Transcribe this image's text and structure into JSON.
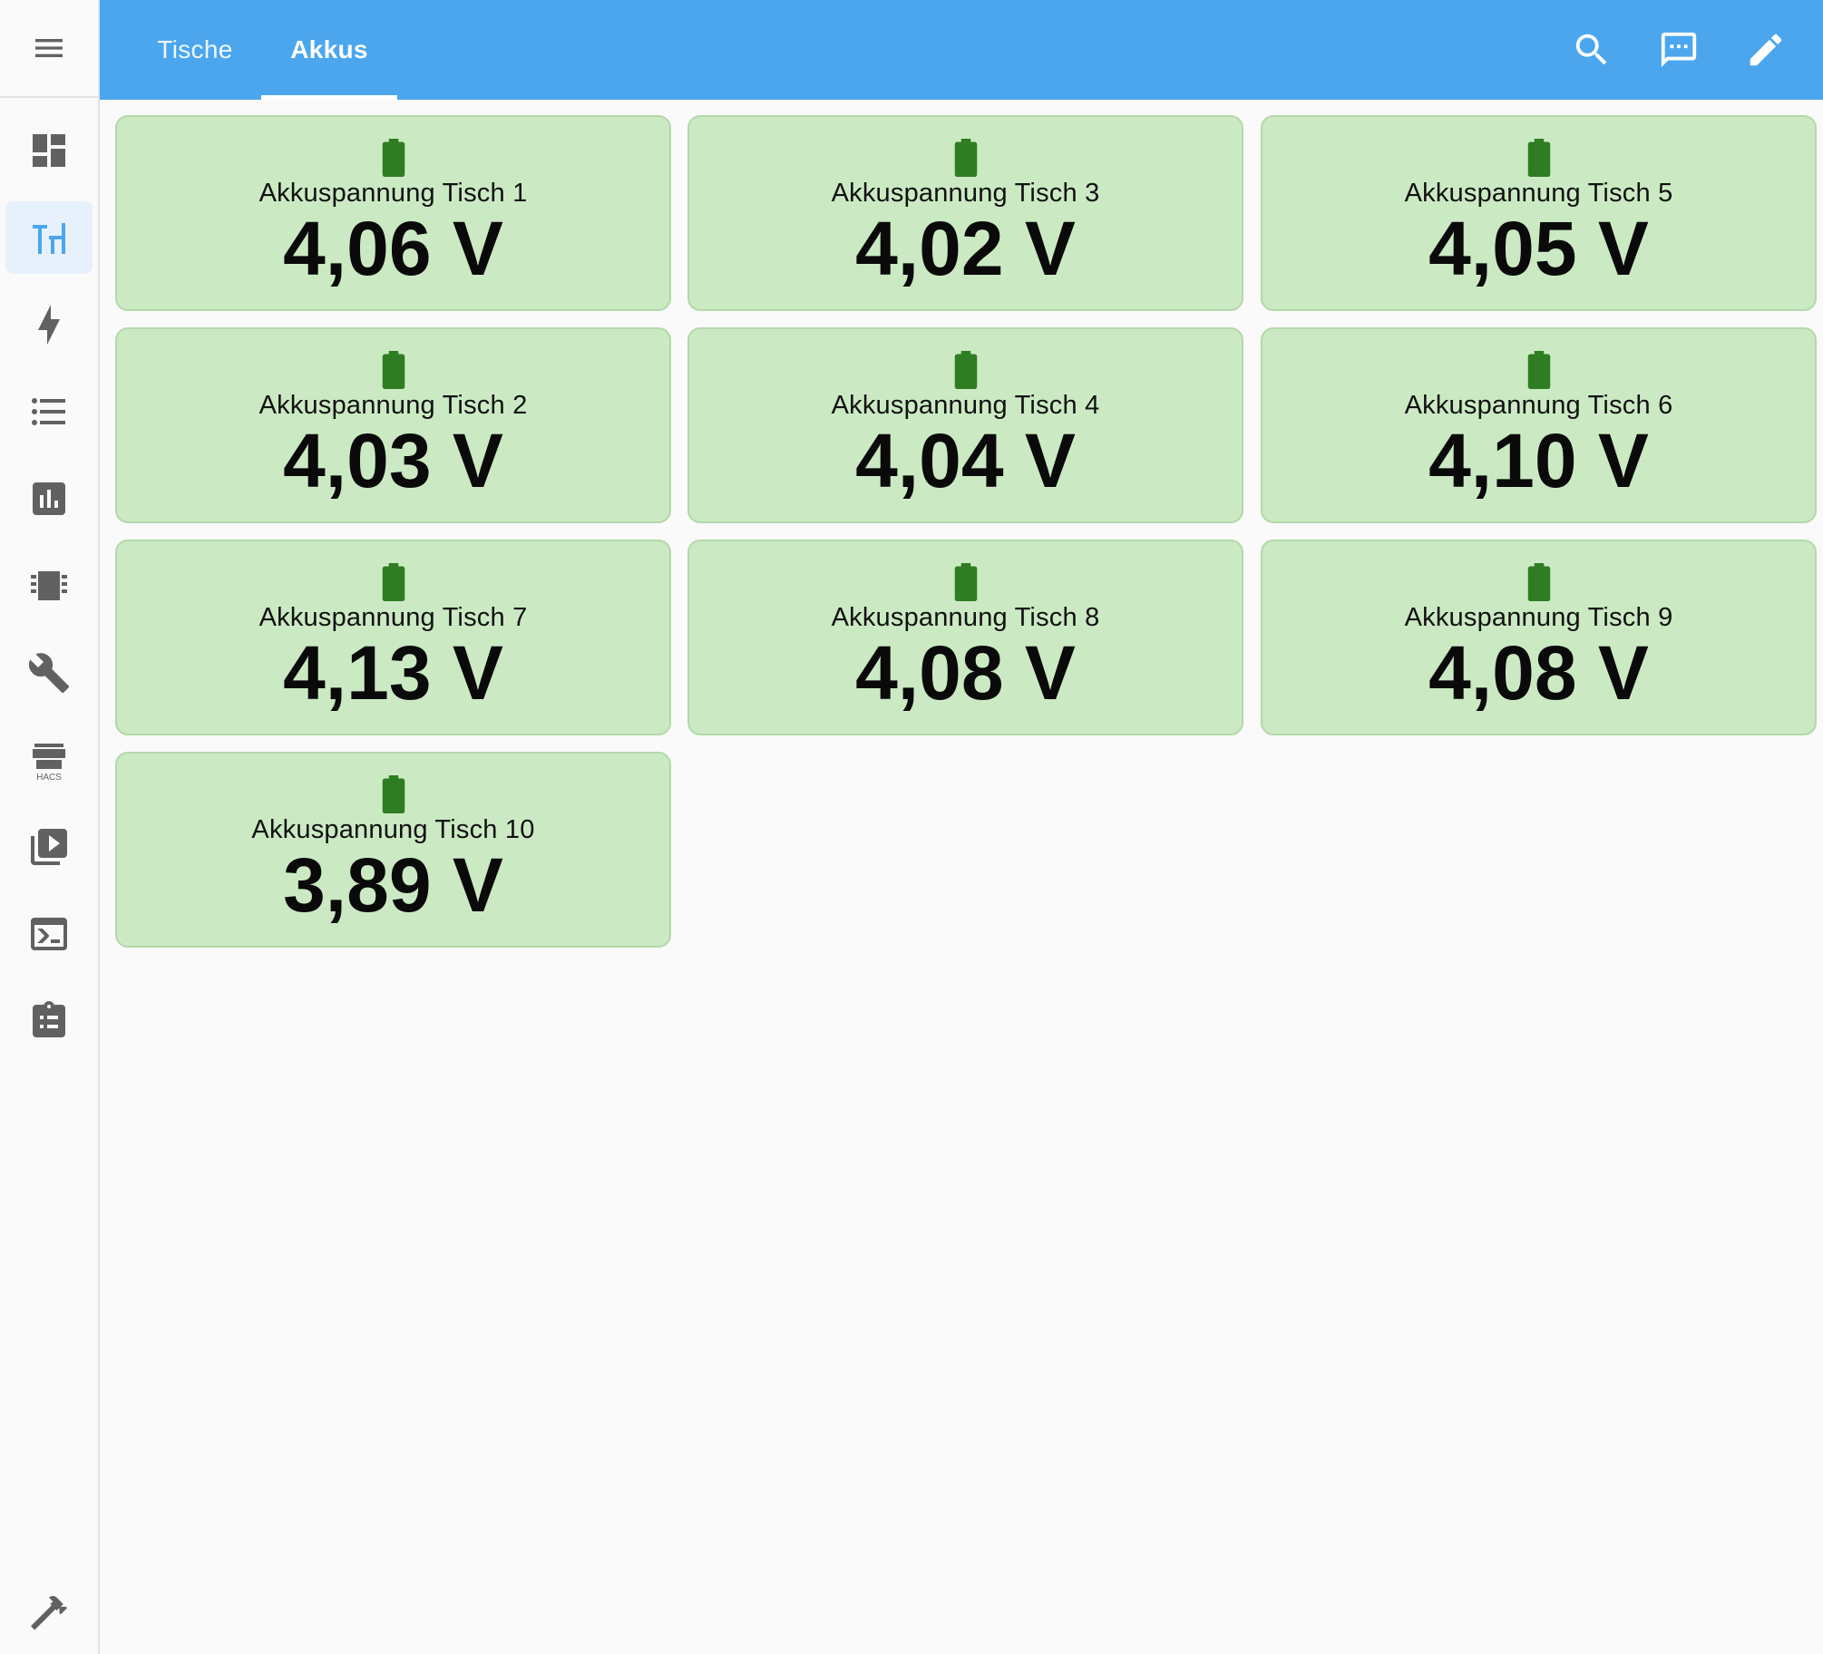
{
  "header": {
    "tabs": [
      {
        "label": "Tische",
        "active": false
      },
      {
        "label": "Akkus",
        "active": true
      }
    ],
    "actions": [
      "search-icon",
      "assist-chat-icon",
      "edit-pencil-icon"
    ]
  },
  "sidebar": {
    "items": [
      {
        "name": "overview",
        "icon": "dashboard-icon",
        "active": false
      },
      {
        "name": "tische-dashboard",
        "icon": "table-custom-icon",
        "active": true
      },
      {
        "name": "energy",
        "icon": "lightning-icon",
        "active": false
      },
      {
        "name": "logbook",
        "icon": "format-list-icon",
        "active": false
      },
      {
        "name": "history",
        "icon": "chart-box-icon",
        "active": false
      },
      {
        "name": "esphome",
        "icon": "chip-icon",
        "active": false
      },
      {
        "name": "settings-tools",
        "icon": "wrench-icon",
        "active": false
      },
      {
        "name": "hacs",
        "icon": "store-icon",
        "label": "HACS",
        "active": false
      },
      {
        "name": "media",
        "icon": "play-box-multiple-icon",
        "active": false
      },
      {
        "name": "terminal",
        "icon": "console-icon",
        "active": false
      },
      {
        "name": "todo",
        "icon": "clipboard-list-icon",
        "active": false
      }
    ],
    "bottom_icon": "hammer-icon"
  },
  "colors": {
    "header": "#4ba6ee",
    "card_bg": "#cbeac3",
    "battery": "#2f7d22",
    "active_sidebar": "#4ba6ee"
  },
  "cards": [
    {
      "name": "Akkuspannung Tisch 1",
      "value": "4,06 V"
    },
    {
      "name": "Akkuspannung Tisch 3",
      "value": "4,02 V"
    },
    {
      "name": "Akkuspannung Tisch 5",
      "value": "4,05 V"
    },
    {
      "name": "Akkuspannung Tisch 2",
      "value": "4,03 V"
    },
    {
      "name": "Akkuspannung Tisch 4",
      "value": "4,04 V"
    },
    {
      "name": "Akkuspannung Tisch 6",
      "value": "4,10 V"
    },
    {
      "name": "Akkuspannung Tisch 7",
      "value": "4,13 V"
    },
    {
      "name": "Akkuspannung Tisch 8",
      "value": "4,08 V"
    },
    {
      "name": "Akkuspannung Tisch 9",
      "value": "4,08 V"
    },
    {
      "name": "Akkuspannung Tisch 10",
      "value": "3,89 V"
    }
  ]
}
